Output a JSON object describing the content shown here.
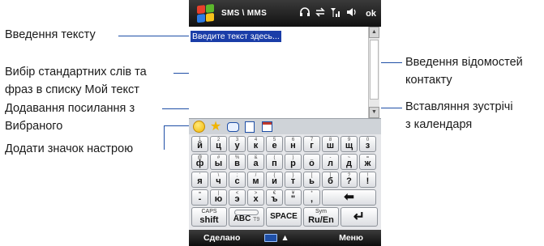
{
  "callouts": {
    "text_input": "Введення тексту",
    "my_text_line1": "Вибір стандартних слів та",
    "my_text_line2": "фраз в списку Мой текст",
    "favorites_line1": "Додавання посилання з",
    "favorites_line2": "Вибраного",
    "emoticon": "Додати значок настрою",
    "contact_line1": "Введення відомостей",
    "contact_line2": "контакту",
    "calendar_line1": "Вставляння зустрічі",
    "calendar_line2": "з календаря"
  },
  "titlebar": {
    "title": "SMS \\ MMS",
    "ok": "ok",
    "status_icons": [
      "headset-icon",
      "sync-icon",
      "signal-icon",
      "speaker-icon"
    ]
  },
  "compose": {
    "placeholder": "Введите текст здесь..."
  },
  "toolbar": {
    "icons": [
      "emoticon-icon",
      "favorites-star-icon",
      "my-text-icon",
      "contact-card-icon",
      "calendar-icon"
    ]
  },
  "keyboard": {
    "rows": [
      [
        {
          "top": "1",
          "main": "й"
        },
        {
          "top": "2",
          "main": "ц"
        },
        {
          "top": "3",
          "main": "у"
        },
        {
          "top": "4",
          "main": "к"
        },
        {
          "top": "5",
          "main": "е"
        },
        {
          "top": "6",
          "main": "н"
        },
        {
          "top": "7",
          "main": "г"
        },
        {
          "top": "8",
          "main": "ш"
        },
        {
          "top": "9",
          "main": "щ"
        },
        {
          "top": "0",
          "main": "з"
        }
      ],
      [
        {
          "top": "@",
          "main": "ф"
        },
        {
          "top": "#",
          "main": "ы"
        },
        {
          "top": "%",
          "main": "в"
        },
        {
          "top": "&",
          "main": "а"
        },
        {
          "top": "(",
          "main": "п"
        },
        {
          "top": ")",
          "main": "р"
        },
        {
          "top": "_",
          "main": "о"
        },
        {
          "top": "-",
          "main": "л"
        },
        {
          "top": "~",
          "main": "д"
        },
        {
          "top": "=",
          "main": "ж"
        }
      ],
      [
        {
          "top": "'",
          "main": "я"
        },
        {
          "top": "\\",
          "main": "ч"
        },
        {
          "top": ";",
          "main": "с"
        },
        {
          "top": "/",
          "main": "м"
        },
        {
          "top": "{",
          "main": "и"
        },
        {
          "top": "}",
          "main": "т"
        },
        {
          "top": "[",
          "main": "ь"
        },
        {
          "top": "]",
          "main": "б"
        },
        {
          "top": "?",
          "main": "?"
        },
        {
          "top": "!",
          "main": "!"
        }
      ],
      [
        {
          "top": "=",
          "main": "-"
        },
        {
          "top": "|",
          "main": "ю"
        },
        {
          "top": "<",
          "main": "э"
        },
        {
          "top": ">",
          "main": "х"
        },
        {
          "top": "€",
          "main": "ъ"
        },
        {
          "top": "¥",
          "main": "\""
        },
        {
          "top": "*",
          "main": ","
        }
      ]
    ],
    "row4": {
      "backspace": "⬅"
    },
    "row5": {
      "caps_top": "CAPS",
      "caps_main": "shift",
      "abc_main": "ABC",
      "abc_t9": "T9",
      "space": "SPACE",
      "sym_top": "Sym",
      "sym_main": "Ru/En",
      "enter": "↵"
    }
  },
  "softkeys": {
    "left": "Сделано",
    "arrow": "▲",
    "right": "Меню"
  },
  "colors": {
    "leader": "#1f4fa6",
    "selection": "#1a3da8",
    "win_red": "#e8402b",
    "win_green": "#5cb82c",
    "win_blue": "#2c7be5",
    "win_yellow": "#f6c21b"
  }
}
